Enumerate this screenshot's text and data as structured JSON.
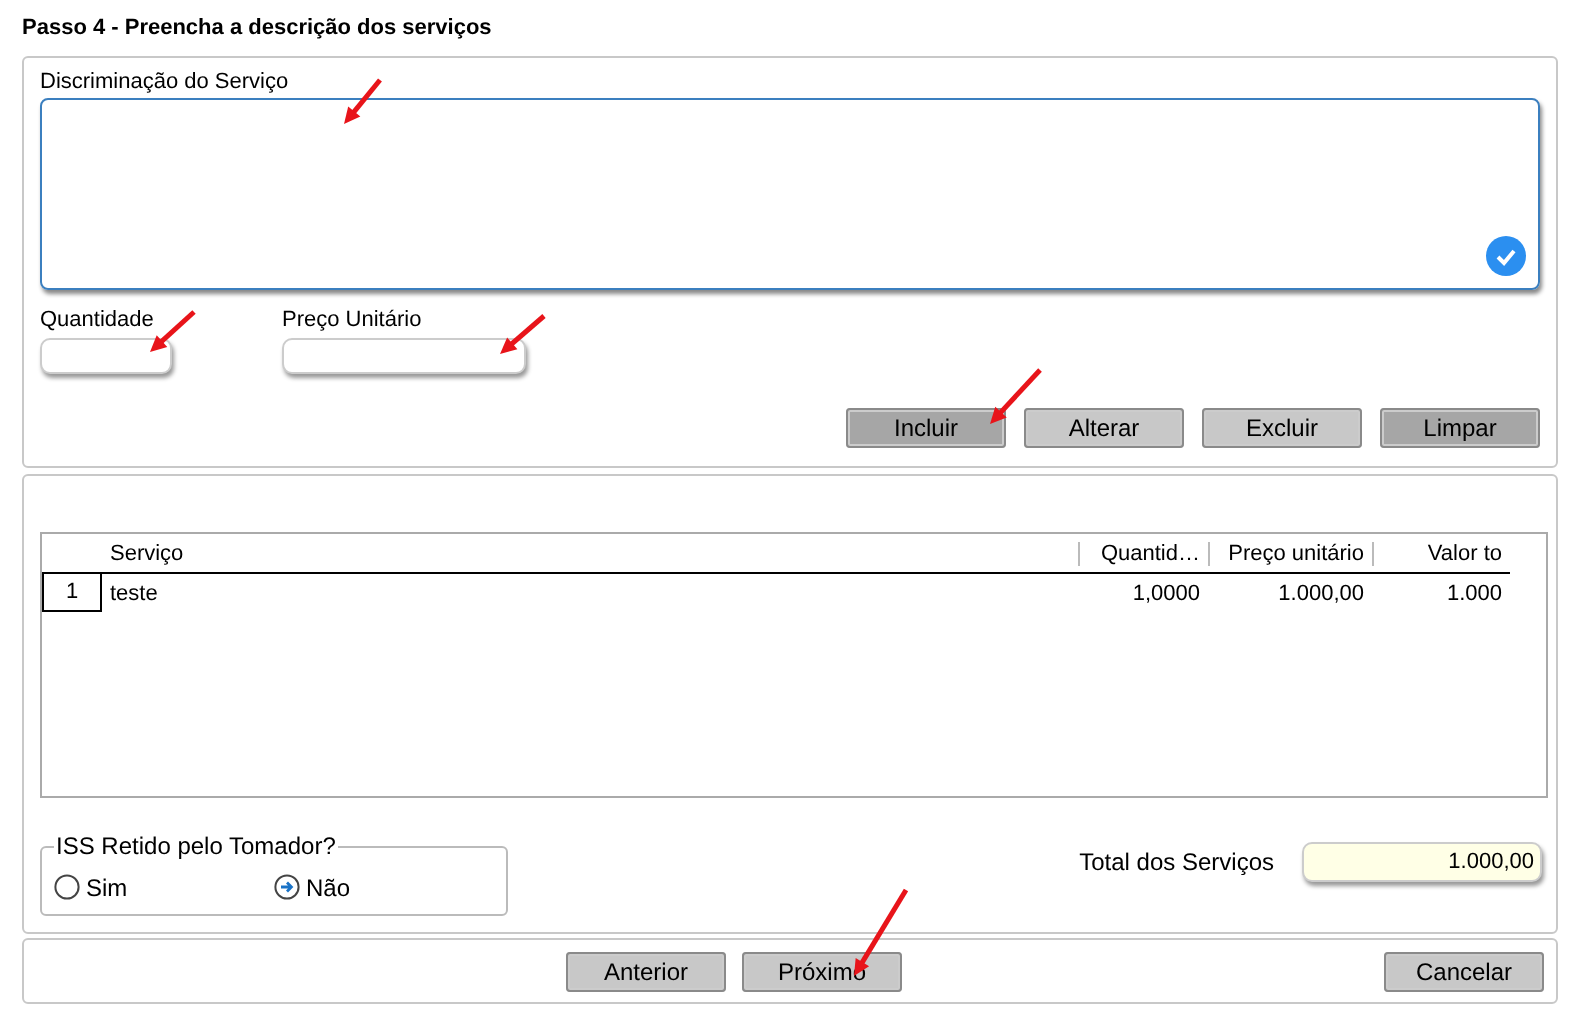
{
  "title": "Passo 4 - Preencha a descrição dos serviços",
  "description": {
    "label": "Discriminação do Serviço"
  },
  "quantity": {
    "label": "Quantidade"
  },
  "unit_price": {
    "label": "Preço Unitário"
  },
  "item_buttons": [
    {
      "label": "Incluir",
      "highlighted": true
    },
    {
      "label": "Alterar",
      "highlighted": false
    },
    {
      "label": "Excluir",
      "highlighted": false
    },
    {
      "label": "Limpar",
      "highlighted": true
    }
  ],
  "table": {
    "columns": [
      "Serviço",
      "Quantid…",
      "Preço unitário",
      "Valor to"
    ],
    "rows": [
      {
        "number": "1",
        "cells": [
          "teste",
          "1,0000",
          "1.000,00",
          "1.000"
        ]
      }
    ]
  },
  "iss": {
    "legend": "ISS Retido pelo Tomador?",
    "options": [
      {
        "label": "Sim",
        "selected": false
      },
      {
        "label": "Não",
        "selected": true
      }
    ]
  },
  "total": {
    "label": "Total dos Serviços",
    "value": "1.000,00"
  },
  "nav_buttons": [
    {
      "label": "Anterior",
      "kind": "nav"
    },
    {
      "label": "Próximo",
      "kind": "nav"
    },
    {
      "label": "Cancelar",
      "kind": "cancel"
    }
  ]
}
